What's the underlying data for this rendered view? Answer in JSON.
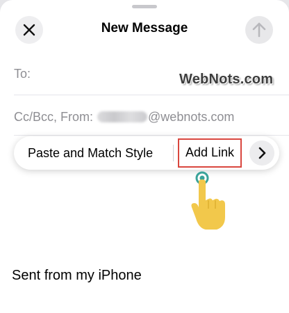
{
  "header": {
    "title": "New Message",
    "close_icon": "close-icon",
    "send_icon": "send-arrow-up-icon"
  },
  "fields": {
    "to_label": "To:",
    "cc_label": "Cc/Bcc, From:",
    "from_domain": "@webnots.com"
  },
  "watermark": "WebNots.com",
  "edit_menu": {
    "paste_match_label": "Paste and Match Style",
    "add_link_label": "Add Link",
    "more_icon": "chevron-right-icon",
    "highlight_color": "#d9463e"
  },
  "pointer": {
    "icon": "tap-hand-icon",
    "hand_color": "#f2c84b",
    "dot_color": "#3aa39a"
  },
  "body": {
    "signature": "Sent from my iPhone"
  }
}
